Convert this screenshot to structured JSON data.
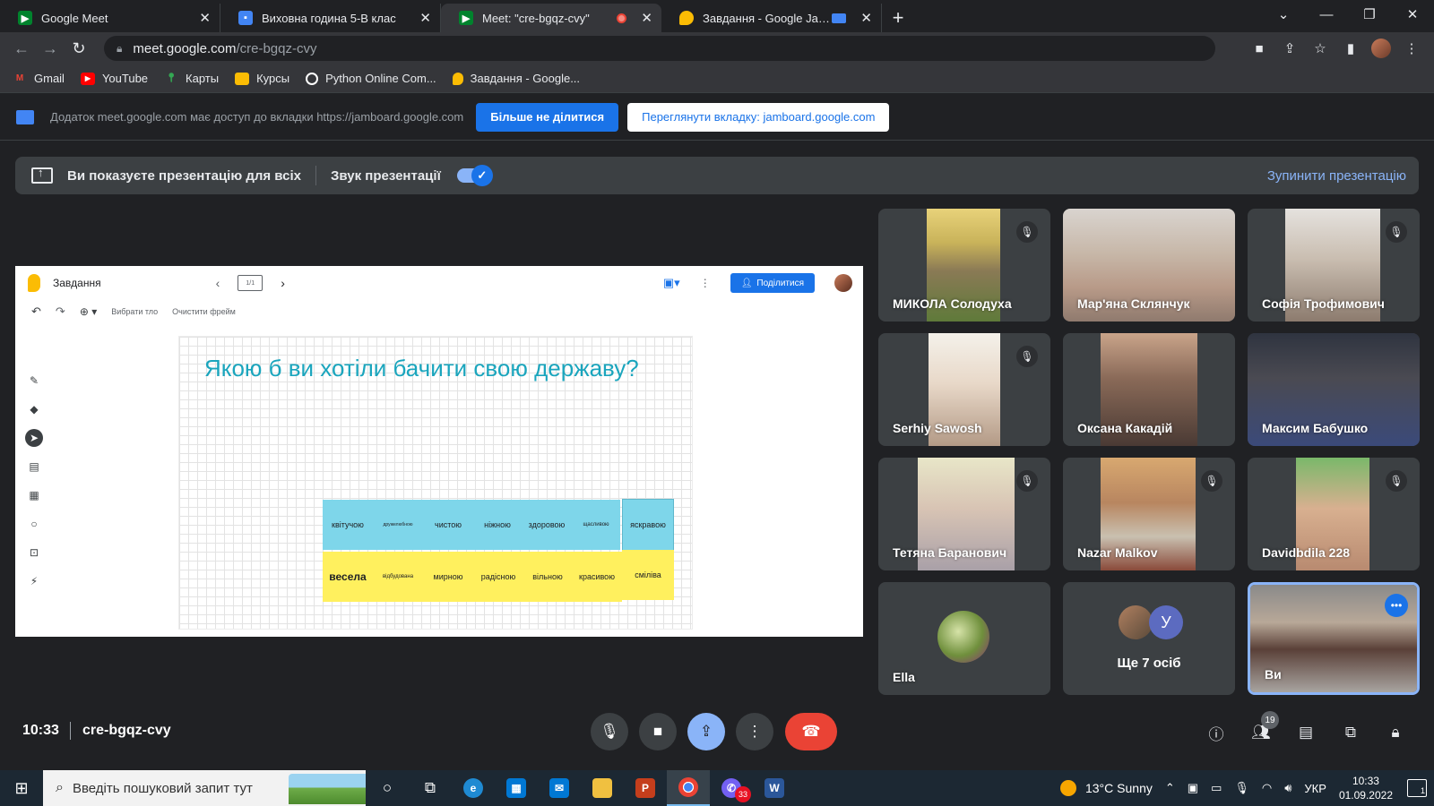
{
  "browser": {
    "tabs": [
      {
        "title": "Google Meet",
        "active": false
      },
      {
        "title": "Виховна година 5-В клас",
        "active": false
      },
      {
        "title": "Meet: \"cre-bgqz-cvy\"",
        "active": true
      },
      {
        "title": "Завдання - Google Jamboard",
        "active": false
      }
    ],
    "new_tab": "+",
    "address": {
      "domain": "meet.google.com",
      "path": "/cre-bgqz-cvy"
    },
    "bookmarks": [
      {
        "label": "Gmail",
        "icon": "gmail-icon",
        "color": "#ea4335"
      },
      {
        "label": "YouTube",
        "icon": "youtube-icon",
        "color": "#ff0000"
      },
      {
        "label": "Карты",
        "icon": "maps-icon",
        "color": "#34a853"
      },
      {
        "label": "Курсы",
        "icon": "courses-icon",
        "color": "#fbbc04"
      },
      {
        "label": "Python Online Com...",
        "icon": "python-icon",
        "color": "#ffffff"
      },
      {
        "label": "Завдання - Google...",
        "icon": "jamboard-icon",
        "color": "#fbbc04"
      }
    ]
  },
  "share_notice": {
    "text": "Додаток meet.google.com має доступ до вкладки https://jamboard.google.com",
    "stop_button": "Більше не ділитися",
    "view_button": "Переглянути вкладку: jamboard.google.com"
  },
  "presentation": {
    "status": "Ви показуєте презентацію для всіх",
    "audio_label": "Звук презентації",
    "audio_on": true,
    "stop_link": "Зупинити презентацію"
  },
  "jamboard": {
    "title": "Завдання",
    "frame_counter": "1/1",
    "share_label": "Поділитися",
    "set_background": "Вибрати тло",
    "clear_frame": "Очистити фрейм",
    "question": "Якою б ви хотіли бачити свою державу?",
    "stickies_top": [
      "квітучою",
      "дружелюбною",
      "чистою",
      "ніжною",
      "здоровою",
      "щасливою",
      "яскравою"
    ],
    "stickies_bottom": [
      "весела",
      "відбудована",
      "мирною",
      "радісною",
      "вільною",
      "красивою",
      "сміліва"
    ]
  },
  "participants": [
    {
      "name": "МИКОЛА Солодуха",
      "muted": true
    },
    {
      "name": "Мар'яна Склянчук",
      "muted": false
    },
    {
      "name": "Софія Трофимович",
      "muted": true
    },
    {
      "name": "Serhiy Sawosh",
      "muted": true
    },
    {
      "name": "Оксана Какадій",
      "muted": false
    },
    {
      "name": "Максим Бабушко",
      "muted": false
    },
    {
      "name": "Тетяна Баранович",
      "muted": true
    },
    {
      "name": "Nazar Malkov",
      "muted": true
    },
    {
      "name": "Davidbdila 228",
      "muted": true
    },
    {
      "name": "Ella",
      "muted": false
    },
    {
      "name": "Ще 7 осіб",
      "muted": false,
      "avatar_letter": "У"
    },
    {
      "name": "Ви",
      "muted": false
    }
  ],
  "meeting": {
    "time": "10:33",
    "code": "cre-bgqz-cvy",
    "people_count": "19"
  },
  "taskbar": {
    "search_placeholder": "Введіть пошуковий запит тут",
    "viber_badge": "33",
    "weather": "13°C  Sunny",
    "language": "УКР",
    "time": "10:33",
    "date": "01.09.2022",
    "notifications": "1"
  }
}
